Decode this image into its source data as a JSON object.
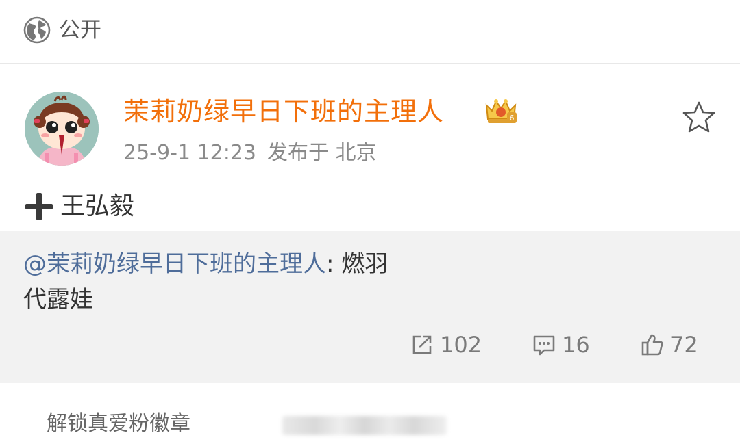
{
  "header": {
    "visibility_icon": "globe-icon",
    "visibility_label": "公开"
  },
  "post": {
    "avatar_icon": "cartoon-girl-avatar",
    "username": "茉莉奶绿早日下班的主理人",
    "badge_icon": "crown-badge-icon",
    "favorite_icon": "star-icon",
    "timestamp": "25-9-1 12:23",
    "location": "发布于 北京",
    "content_icon": "plus-icon",
    "content_text": "王弘毅"
  },
  "repost": {
    "mention": "@茉莉奶绿早日下班的主理人",
    "separator": ": ",
    "text_line1": "燃羽",
    "text_line2": "代露娃",
    "stats": {
      "reposts": "102",
      "comments": "16",
      "likes": "72"
    },
    "icons": {
      "repost": "share-icon",
      "comment": "comment-icon",
      "like": "thumbs-up-icon"
    }
  },
  "footer": {
    "unlock_label": "解锁真爱粉徽章"
  },
  "colors": {
    "username": "#f26f0a",
    "mention": "#4f6d9a",
    "repost_bg": "#f2f2f2"
  }
}
